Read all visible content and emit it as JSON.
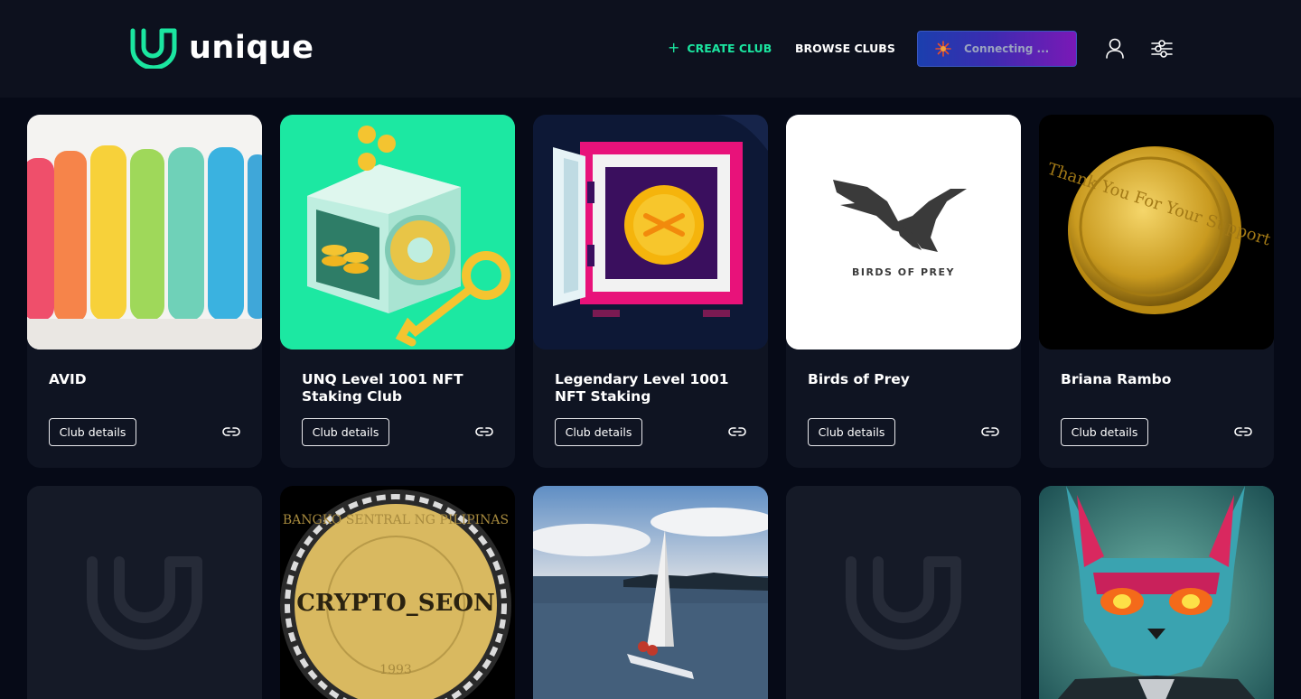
{
  "header": {
    "brand": "unique",
    "create_club": "CREATE CLUB",
    "create_plus": "+",
    "browse_clubs": "BROWSE CLUBS",
    "connect_status": "Connecting ...",
    "icons": [
      "logo-mark-icon",
      "plus-icon",
      "spark-icon",
      "user-icon",
      "settings-sliders-icon"
    ]
  },
  "colors": {
    "accent_green": "#1be6a0",
    "background": "#060a17",
    "header_bg": "#0d111e",
    "card_bg": "#0f1422",
    "connect_gradient_start": "#1b3fae",
    "connect_gradient_end": "#7a19b6"
  },
  "clubs_row1": [
    {
      "title": "AVID",
      "button": "Club details",
      "art": "chalk-sticks"
    },
    {
      "title": "UNQ Level 1001 NFT Staking Club",
      "button": "Club details",
      "art": "vault-coins-key"
    },
    {
      "title": "Legendary Level 1001 NFT Staking",
      "button": "Club details",
      "art": "open-safe-coin"
    },
    {
      "title": "Birds of Prey",
      "button": "Club details",
      "art": "eagle-logo",
      "art_text": "BIRDS OF PREY"
    },
    {
      "title": "Briana Rambo",
      "button": "Club details",
      "art": "gold-coin",
      "art_text": "Thank You For Your Support"
    }
  ],
  "clubs_row2": [
    {
      "art": "unique-placeholder"
    },
    {
      "art": "crypto-seon-coin",
      "art_text": "CRYPTO_SEON",
      "art_ring_text": "BANGKO SENTRAL NG PILIPINAS",
      "art_year": "1993"
    },
    {
      "art": "sailboat-sea"
    },
    {
      "art": "unique-placeholder"
    },
    {
      "art": "angry-cat"
    }
  ]
}
